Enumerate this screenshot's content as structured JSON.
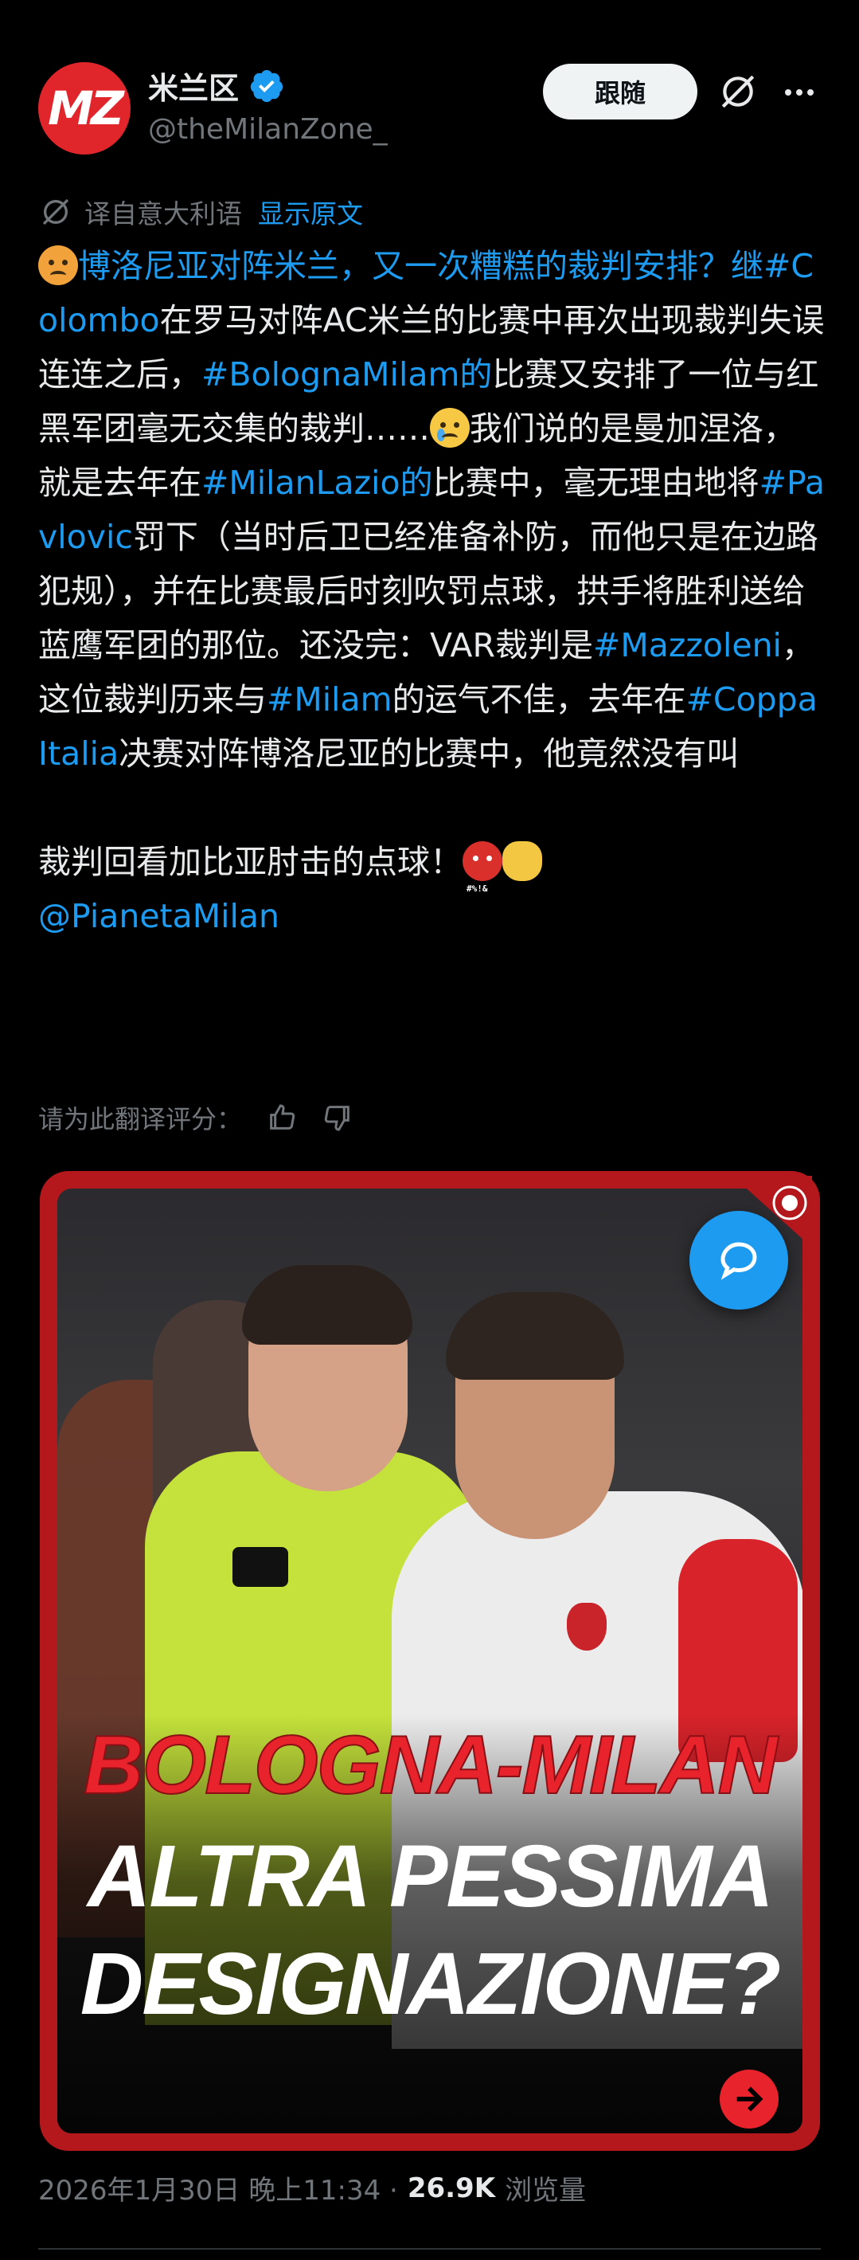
{
  "author": {
    "display_name": "米兰区",
    "handle": "@theMilanZone_",
    "avatar_text": "MZ"
  },
  "actions": {
    "follow_label": "跟随"
  },
  "translation": {
    "label": "译自意大利语",
    "show_original": "显示原文"
  },
  "tweet": {
    "segments": [
      {
        "type": "emoji",
        "name": "angry-face-emoji"
      },
      {
        "type": "link",
        "text": "博洛尼亚对阵米兰，又一次糟糕的裁判安排？继#Colombo"
      },
      {
        "type": "text",
        "text": "在罗马对阵AC米兰的比赛中再次出现裁判失误连连之后，"
      },
      {
        "type": "link",
        "text": "#BolognaMilam的"
      },
      {
        "type": "text",
        "text": "比赛又安排了一位与红黑军团毫无交集的裁判……"
      },
      {
        "type": "emoji",
        "name": "crying-face-emoji"
      },
      {
        "type": "text",
        "text": "我们说的是曼加涅洛，就是去年在"
      },
      {
        "type": "link",
        "text": "#MilanLazio的"
      },
      {
        "type": "text",
        "text": "比赛中，毫无理由地将"
      },
      {
        "type": "link",
        "text": "#Pavlovic"
      },
      {
        "type": "text",
        "text": "罚下（当时后卫已经准备补防，而他只是在边路犯规），并在比赛最后时刻吹罚点球，拱手将胜利送给蓝鹰军团的那位。还没完：VAR裁判是"
      },
      {
        "type": "link",
        "text": "#Mazzoleni"
      },
      {
        "type": "text",
        "text": "，这位裁判历来与"
      },
      {
        "type": "link",
        "text": "#Milam"
      },
      {
        "type": "text",
        "text": "的运气不佳，去年在"
      },
      {
        "type": "link",
        "text": "#CoppaItalia"
      },
      {
        "type": "text",
        "text": "决赛对阵博洛尼亚的比赛中，他竟然没有叫\n\n裁判回看加比亚肘击的点球！"
      },
      {
        "type": "emoji",
        "name": "cursing-face-emoji"
      },
      {
        "type": "emoji",
        "name": "clapping-hands-emoji"
      },
      {
        "type": "text",
        "text": "\n"
      },
      {
        "type": "link",
        "text": "@PianetaMilan"
      }
    ]
  },
  "rating": {
    "label": "请为此翻译评分："
  },
  "media": {
    "headline_line1": "BOLOGNA-MILAN",
    "headline_line2": "ALTRA PESSIMA",
    "headline_line3": "DESIGNAZIONE?"
  },
  "meta": {
    "timestamp": "2026年1月30日 晚上11:34 · ",
    "views": "26.9K",
    "views_label": "浏览量"
  },
  "colors": {
    "accent": "#1d9bf0",
    "background": "#000000",
    "brand_red": "#e0262b"
  }
}
